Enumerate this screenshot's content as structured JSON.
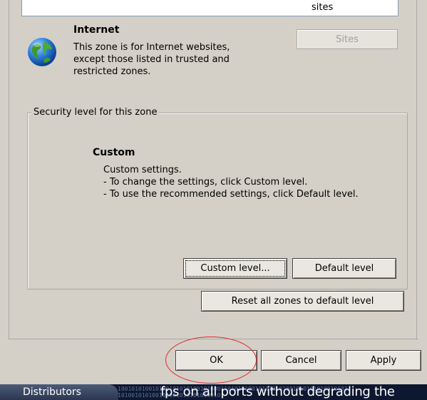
{
  "zone_list": {
    "visible_text": "sites"
  },
  "zone": {
    "name": "Internet",
    "icon": "globe-icon",
    "description_lines": [
      "This zone is for Internet websites,",
      "except those listed in trusted and",
      "restricted zones."
    ],
    "sites_button": "Sites",
    "sites_button_enabled": false
  },
  "security_level": {
    "group_label": "Security level for this zone",
    "level_name": "Custom",
    "lines": [
      "Custom settings.",
      "- To change the settings, click Custom level.",
      "- To use the recommended settings, click Default level."
    ],
    "custom_level_button": "Custom level...",
    "default_level_button": "Default level"
  },
  "reset_button": "Reset all zones to default level",
  "dialog_buttons": {
    "ok": "OK",
    "cancel": "Cancel",
    "apply": "Apply"
  },
  "annotation": {
    "color": "#e02a2a",
    "target": "OK"
  },
  "background_strip": {
    "left_text": "Distributors",
    "binary_text": "1001010100101001010101001010001101010100101010101001010101010010101",
    "binary_text_2": "1010010101001010010101010100101",
    "right_text": "fps on all ports without degrading the"
  }
}
